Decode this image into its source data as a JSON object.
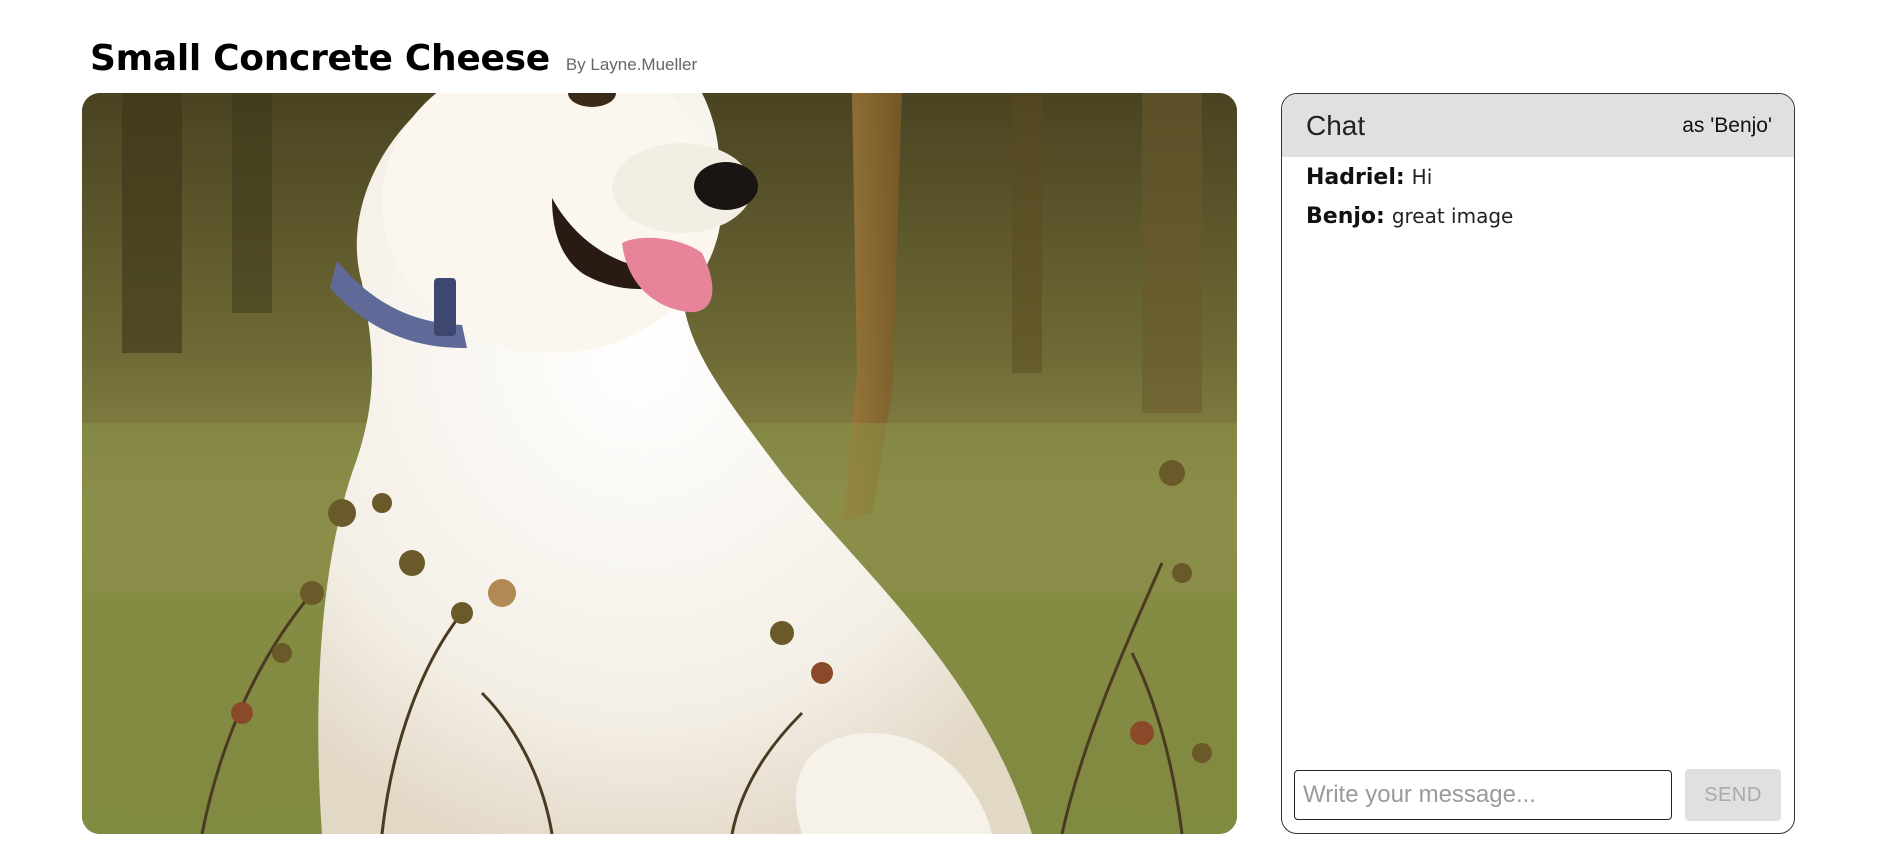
{
  "page": {
    "title": "Small Concrete Cheese",
    "byline": "By Layne.Mueller"
  },
  "image": {
    "subject": "white dog sitting in grass field"
  },
  "chat": {
    "title": "Chat",
    "current_user": "as 'Benjo'",
    "messages": [
      {
        "author": "Hadriel:",
        "text": "Hi"
      },
      {
        "author": "Benjo:",
        "text": "great image"
      }
    ],
    "input": {
      "value": "",
      "placeholder": "Write your message..."
    },
    "send_label": "SEND"
  },
  "colors": {
    "chat_header_bg": "#e0e0e0",
    "send_button_bg": "#e0e0e0",
    "send_button_text": "#a9a9a9",
    "byline": "#666666"
  }
}
